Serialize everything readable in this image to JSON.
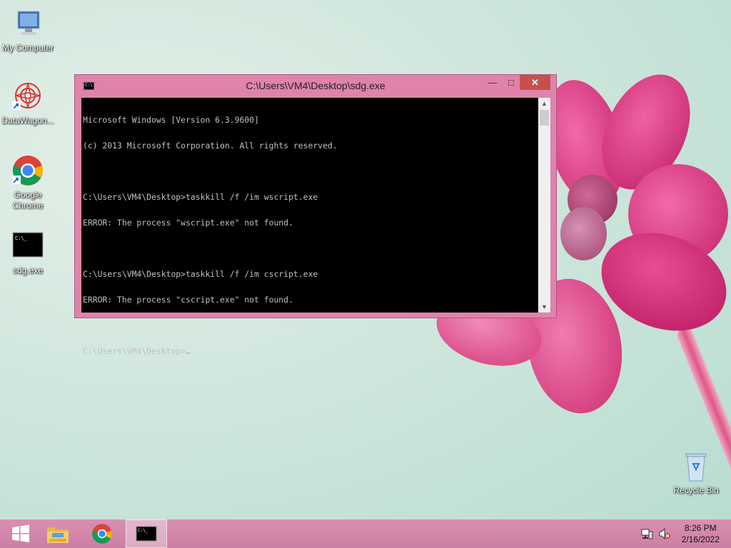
{
  "desktop": {
    "icons": [
      {
        "label": "My Computer"
      },
      {
        "label": "DataWagon..."
      },
      {
        "label": "Google Chrome"
      },
      {
        "label": "sdg.exe"
      },
      {
        "label": "Recycle Bin"
      }
    ]
  },
  "window": {
    "title": "C:\\Users\\VM4\\Desktop\\sdg.exe",
    "buttons": {
      "minimize": "—",
      "maximize": "□",
      "close": "✕"
    },
    "console_lines": [
      "Microsoft Windows [Version 6.3.9600]",
      "(c) 2013 Microsoft Corporation. All rights reserved.",
      "",
      "C:\\Users\\VM4\\Desktop>taskkill /f /im wscript.exe",
      "ERROR: The process \"wscript.exe\" not found.",
      "",
      "C:\\Users\\VM4\\Desktop>taskkill /f /im cscript.exe",
      "ERROR: The process \"cscript.exe\" not found.",
      ""
    ],
    "prompt": "C:\\Users\\VM4\\Desktop>"
  },
  "taskbar": {
    "clock_time": "8:26 PM",
    "clock_date": "2/16/2022",
    "items": [
      "windows-start-icon",
      "file-explorer-icon",
      "chrome-icon",
      "cmd-icon"
    ]
  },
  "colors": {
    "titlebar": "#df83ad",
    "close_button": "#c7504c",
    "console_bg": "#000000",
    "console_fg": "#c0c0c0"
  }
}
